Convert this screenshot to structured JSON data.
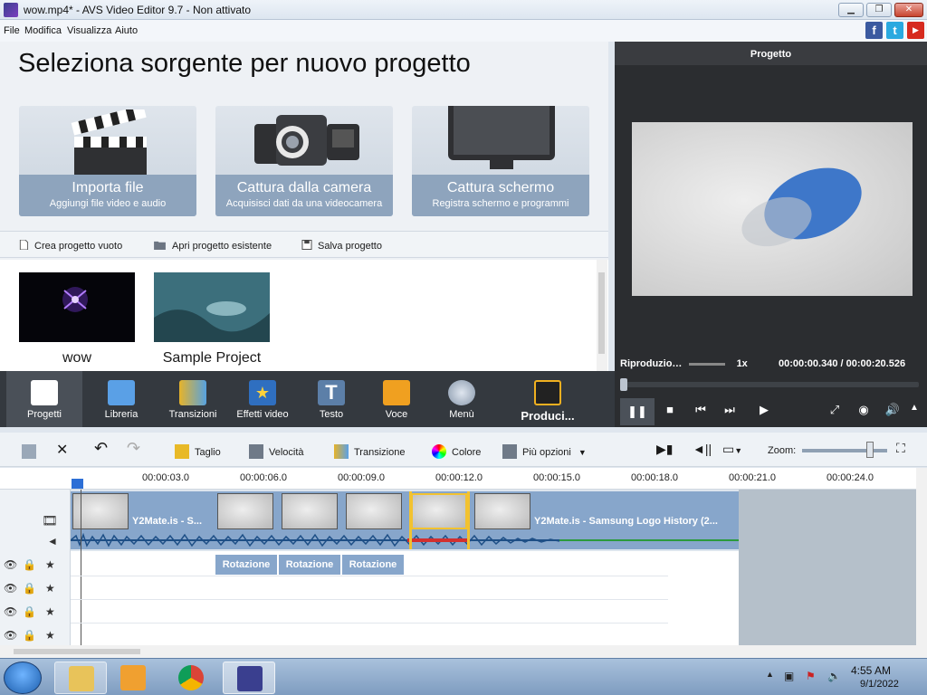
{
  "window": {
    "title": "wow.mp4* - AVS Video Editor 9.7 - Non attivato",
    "min": "▁",
    "max": "❐",
    "close": "✕"
  },
  "menu": [
    "File",
    "Modifica",
    "Visualizza",
    "Aiuto"
  ],
  "social": {
    "facebook": "f",
    "twitter": "t",
    "youtube": "▶"
  },
  "start_panel": {
    "heading": "Seleziona sorgente per nuovo progetto",
    "cards": [
      {
        "title": "Importa file",
        "subtitle": "Aggiungi file video e audio",
        "icon": "clapperboard-icon"
      },
      {
        "title": "Cattura dalla camera",
        "subtitle": "Acquisisci dati da una videocamera",
        "icon": "camcorder-icon"
      },
      {
        "title": "Cattura schermo",
        "subtitle": "Registra schermo e programmi",
        "icon": "monitor-icon"
      }
    ],
    "actions": [
      "Crea progetto vuoto",
      "Apri progetto esistente",
      "Salva progetto"
    ],
    "recent": [
      {
        "name": "wow"
      },
      {
        "name": "Sample Project"
      }
    ]
  },
  "preview": {
    "title": "Progetto",
    "mode": "Riproduzio…",
    "speed": "1x",
    "time_current": "00:00:00.340",
    "time_separator": "/",
    "time_total": "00:00:20.526"
  },
  "tabs": [
    "Progetti",
    "Libreria",
    "Transizioni",
    "Effetti video",
    "Testo",
    "Voce",
    "Menù",
    "Produci..."
  ],
  "edit_tools": {
    "trim": "Taglio",
    "speed": "Velocità",
    "transition": "Transizione",
    "color": "Colore",
    "more": "Più opzioni",
    "zoom": "Zoom:"
  },
  "ruler": [
    "00:00:03.0",
    "00:00:06.0",
    "00:00:09.0",
    "00:00:12.0",
    "00:00:15.0",
    "00:00:18.0",
    "00:00:21.0",
    "00:00:24.0"
  ],
  "clips": {
    "left_label": "Y2Mate.is - S...",
    "right_label": "Y2Mate.is - Samsung Logo History (2..."
  },
  "effects": [
    "Rotazione",
    "Rotazione",
    "Rotazione"
  ],
  "taskbar": {
    "time": "4:55 AM",
    "date": "9/1/2022"
  },
  "colors": {
    "accent": "#2d6fd6",
    "clip": "#87a6cb",
    "dark_panel": "#34393f",
    "card_band": "#8ea4bd"
  }
}
